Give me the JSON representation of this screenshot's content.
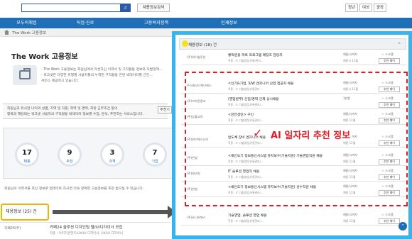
{
  "header": {
    "search_button_icon": "search-icon",
    "recruit_search_label": "채용정보검색",
    "age_tabs": [
      "청년",
      "여성",
      "중장"
    ]
  },
  "nav": [
    "모두의취업",
    "직업·진로",
    "고용복지정책",
    "인재정보"
  ],
  "breadcrumb": "The Work 고용정보",
  "page_title": "The Work 고용정보",
  "intro": {
    "line1": "- The Work 고용정보는 회원님에서 작성하신 이력서 및 구직활동 정보와 자발정책...",
    "line2": "- 워크넷은 다양한 유형별 사용자들의 누적된 구직활동 관련 빅데이터를 근간...",
    "line3": "  서비스 제공하고 있습니다."
  },
  "desc": {
    "line1": "회원님과 유사한 나이와 성별, 지역 및 직종, 학력 및 경력, 희망 근무조건 등의",
    "line2": "항목과 해당되는 워크넷 사용자의 구직활동 빅데이터 정보를 수집, 분석, 추천하는 서비스입니다.",
    "button": "추천기"
  },
  "stats": [
    {
      "value": "17",
      "label": "채용"
    },
    {
      "value": "9",
      "label": "추천"
    },
    {
      "value": "3",
      "label": "과격"
    },
    {
      "value": "7",
      "label": "기업"
    }
  ],
  "notice": "회원님의 이력서를 최신 정보로 업데이트 하시면 더욱 정확한 고용정보를 추천 받으실 수 있습니다.",
  "recruit_total": "채용정보 (25) 건",
  "bottom_job": {
    "company": "카페24(주)",
    "title": "카페24 솔루션 디자인팀 웹/UI디자이너 모집",
    "meta": "직종 : 이미지콘텐츠/UX/UI 디자이너, UX/UI 디자이너"
  },
  "popup": {
    "header": "채용정보 (18) 건",
    "jobs": [
      {
        "company": "(주)와이솔루션",
        "title": "빵떡원을 파트 프로그램 매장즈 담당자",
        "meta": "직종 : IT 기술영업/유통/관리...",
        "type": "채용/시까지",
        "deadline": "채용시 11월",
        "scrap": "☆ 스크랩",
        "recommend": "추천 페이"
      },
      {
        "company": "주식회사디케이에스",
        "title": "<인기&기업, S/W 엔지니어 산업 접공자 채용",
        "meta": "직종 : IT 기술영업/유통관리...",
        "type": "채용/시까지",
        "deadline": "채용시 11월",
        "scrap": "☆ 스크랩",
        "recommend": "추천 페이"
      },
      {
        "company": "(주)브라운앤코",
        "title": "(영업분부) 신입/경력 인제 상시채용",
        "meta": "직종 : IT 기술영업/유통관리/...",
        "type": "1만원",
        "deadline": "",
        "scrap": "☆ 스크랩",
        "recommend": "추천 페이"
      },
      {
        "company": "(주)능률교육",
        "title": "<반전생민> 구인",
        "meta": "직종 : IT 기술영업/유통관리/...",
        "type": "채용/시까지",
        "deadline": "채용 11월",
        "scrap": "☆ 스크랩",
        "recommend": "추천 페이"
      },
      {
        "company": "(주)와이에스시티",
        "title": "반도체 장비 엔지니어 채용",
        "meta": "직종 : IT 기술영업/유통관리/...",
        "type": "채용/시까지",
        "deadline": "채용 11월",
        "scrap": "☆ 스크랩",
        "recommend": "추천 페이"
      },
      {
        "company": "(주)한빛",
        "title": "<채인도기 정보통신시스템 유지보수(기술지원) 기술영업직원 채용",
        "meta": "직종 : IT 기술영업/유통관리/...",
        "type": "채용/시까지",
        "deadline": "채용 11월",
        "scrap": "☆ 스크랩",
        "recommend": "추천 페이"
      },
      {
        "company": "(주)테크원",
        "title": "IT 솔루션 영업직 채용",
        "meta": "직종 : IT 기술영업/유통관리/...",
        "type": "채용/시까지",
        "deadline": "채용 11월",
        "scrap": "☆ 스크랩",
        "recommend": "추천 페이"
      },
      {
        "company": "(주)한빛",
        "title": "<채인도기 정보통신시스템 유지보수(기술지원) 성수직원 채용",
        "meta": "직종 : IT 기술영업/유통관리/...",
        "type": "채용/시까지",
        "deadline": "채용 11월",
        "scrap": "☆ 스크랩",
        "recommend": "추천 페이"
      },
      {
        "company": "(주)유니비에스",
        "title": "기술영업, 솔루션 영업 채용",
        "meta": "직종 : IT 기술영업/유통관리/...",
        "type": "채용/시까지",
        "deadline": "채용 11월",
        "scrap": "☆ 스크랩",
        "recommend": "추천 페이"
      }
    ],
    "ai_label": "AI 일자리 추천 정보",
    "ai_check": "✓",
    "fab_icon": "chevron-up-icon"
  },
  "colors": {
    "nav_blue": "#1e6fb8",
    "popup_border": "#39b3ec",
    "highlight_red": "#e51c23",
    "total_border": "#f0b400"
  }
}
